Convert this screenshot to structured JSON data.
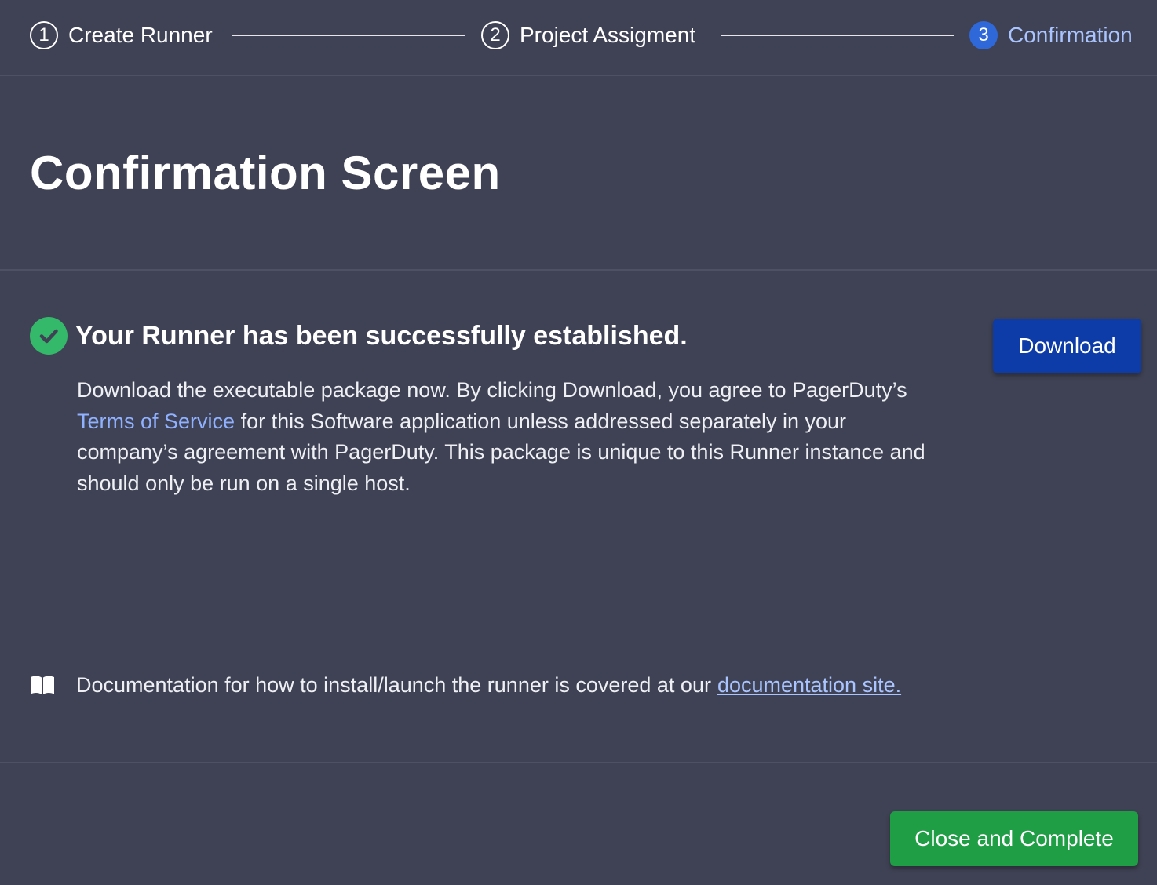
{
  "stepper": {
    "steps": [
      {
        "number": "1",
        "label": "Create Runner"
      },
      {
        "number": "2",
        "label": "Project Assigment"
      },
      {
        "number": "3",
        "label": "Confirmation"
      }
    ],
    "active_step": "3"
  },
  "header": {
    "title": "Confirmation Screen"
  },
  "success": {
    "icon": "check-circle-icon",
    "title": "Your Runner has been successfully established.",
    "description_before_link": "Download the executable package now. By clicking Download, you agree to PagerDuty’s ",
    "terms_link": "Terms of Service",
    "description_after_link": " for this Software application unless addressed separately in your company’s agreement with PagerDuty. This package is unique to this Runner instance and should only be run on a single host."
  },
  "actions": {
    "download_label": "Download",
    "close_label": "Close and Complete"
  },
  "documentation": {
    "icon": "book-icon",
    "text": "Documentation for how to install/launch the runner is covered at our",
    "link_text": "documentation site."
  },
  "colors": {
    "background": "#3f4254",
    "active_step": "#2f68d8",
    "link": "#8fb1ff",
    "success": "#34b86a",
    "download_button": "#0d3ba7",
    "close_button": "#1f9e46"
  }
}
